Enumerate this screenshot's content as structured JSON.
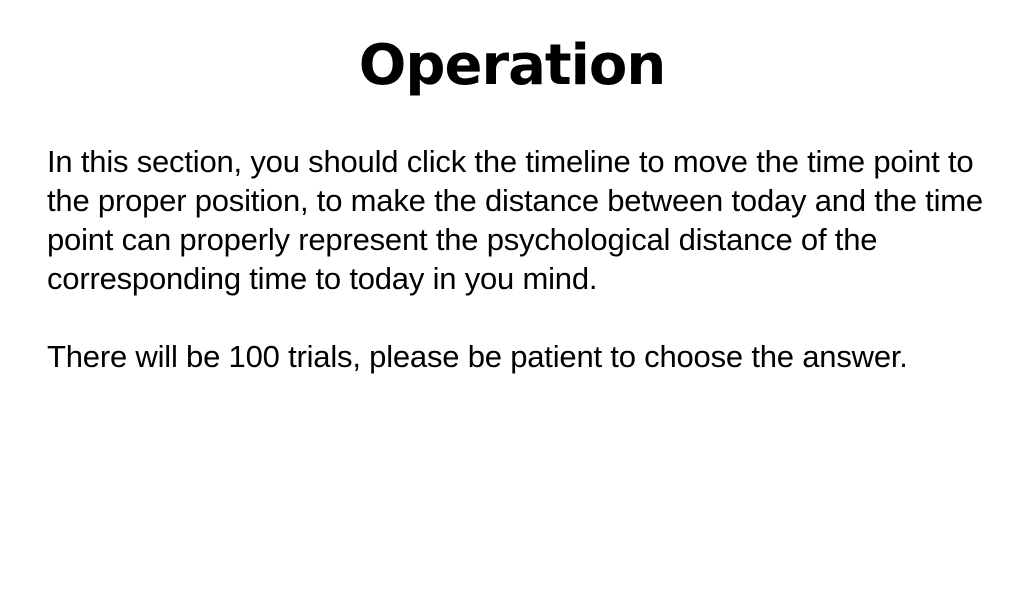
{
  "screen": {
    "title": "Operation",
    "paragraphs": [
      "In this section, you should click the timeline to move the time point to the proper position, to make the distance between today and the time point can properly represent the psychological distance of the corresponding time to today in you mind.",
      "There will be 100 trials, please be patient to choose the answer."
    ]
  }
}
